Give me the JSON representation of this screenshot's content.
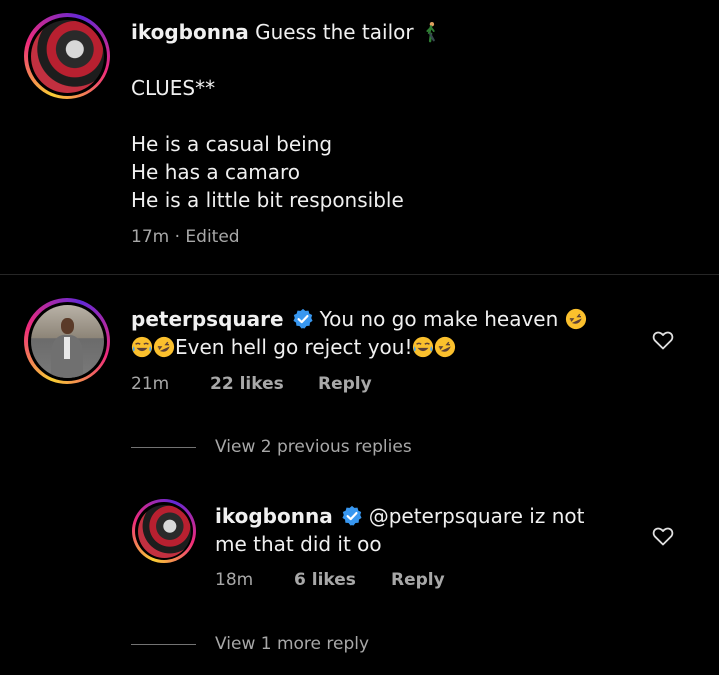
{
  "post": {
    "username": "ikogbonna",
    "caption_first": "Guess the tailor",
    "lines": [
      "CLUES**",
      "He is a casual being",
      "He has a camaro",
      "He is a little bit responsible"
    ],
    "time": "17m",
    "edited": "· Edited"
  },
  "comment": {
    "username": "peterpsquare",
    "text_line1": "You no go make heaven",
    "text_line2": "Even hell go reject you!",
    "time": "21m",
    "likes": "22 likes",
    "reply_label": "Reply",
    "view_previous": "View 2 previous replies"
  },
  "reply": {
    "username": "ikogbonna",
    "text_line1": "@peterpsquare iz not",
    "text_line2": "me that did it oo",
    "time": "18m",
    "likes": "6 likes",
    "reply_label": "Reply",
    "view_more": "View 1 more reply"
  },
  "colors": {
    "background": "#000000",
    "verified_blue": "#3897f0",
    "secondary_text": "#a8a8a8"
  },
  "icons": [
    "walking-person-icon",
    "verified-badge-icon",
    "rofl-emoji-icon",
    "joy-emoji-icon",
    "heart-outline-icon"
  ]
}
